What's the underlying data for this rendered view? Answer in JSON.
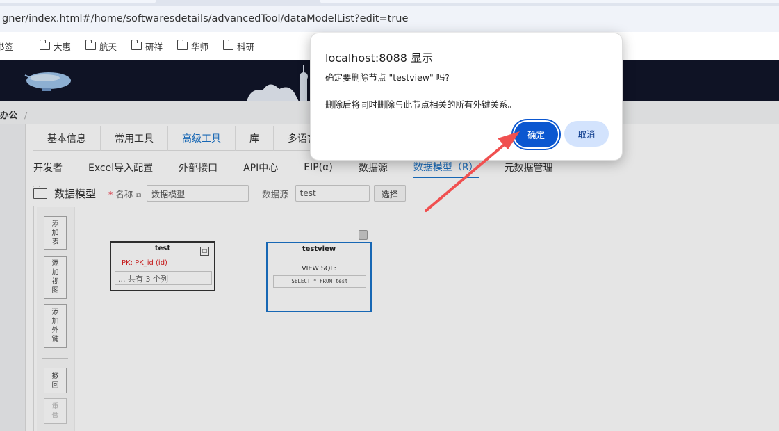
{
  "browser": {
    "url": "gner/index.html#/home/softwaresdetails/advancedTool/dataModelList?edit=true",
    "bookmarks": [
      "书签",
      "大惠",
      "航天",
      "研祥",
      "华师",
      "科研"
    ]
  },
  "breadcrumb": {
    "item": "办公",
    "separator": "/"
  },
  "main_tabs": [
    "基本信息",
    "常用工具",
    "高级工具",
    "库",
    "多语言"
  ],
  "main_tabs_active": "高级工具",
  "sub_tabs": [
    "开发者",
    "Excel导入配置",
    "外部接口",
    "API中心",
    "EIP(α)",
    "数据源",
    "数据模型（R）",
    "元数据管理"
  ],
  "sub_tabs_active": "数据模型（R）",
  "section": {
    "title": "数据模型",
    "name_label": "名称",
    "name_required": "*",
    "name_value": "数据模型",
    "datasource_label": "数据源",
    "datasource_value": "test",
    "select_button": "选择"
  },
  "toolbar": {
    "add_table": [
      "添",
      "加",
      "表"
    ],
    "add_view": [
      "添",
      "加",
      "视",
      "图"
    ],
    "add_fk": [
      "添",
      "加",
      "外",
      "键"
    ],
    "undo": [
      "撤",
      "回"
    ],
    "redo": [
      "重",
      "做"
    ]
  },
  "nodes": {
    "test": {
      "title": "test",
      "pk": "PK: PK_id (id)",
      "columns": "... 共有 3 个列",
      "min": "□"
    },
    "testview": {
      "title": "testview",
      "view_label": "VIEW SQL:",
      "sql": "SELECT * FROM test"
    }
  },
  "dialog": {
    "title": "localhost:8088 显示",
    "message": "确定要删除节点 \"testview\" 吗?",
    "detail": "删除后将同时删除与此节点相关的所有外键关系。",
    "ok": "确定",
    "cancel": "取消"
  },
  "colors": {
    "primary": "#0b57d0",
    "cancel_bg": "#d3e3fd",
    "arrow": "#f05050",
    "header_bg": "#11162a",
    "active_tab": "#1a73c9"
  }
}
